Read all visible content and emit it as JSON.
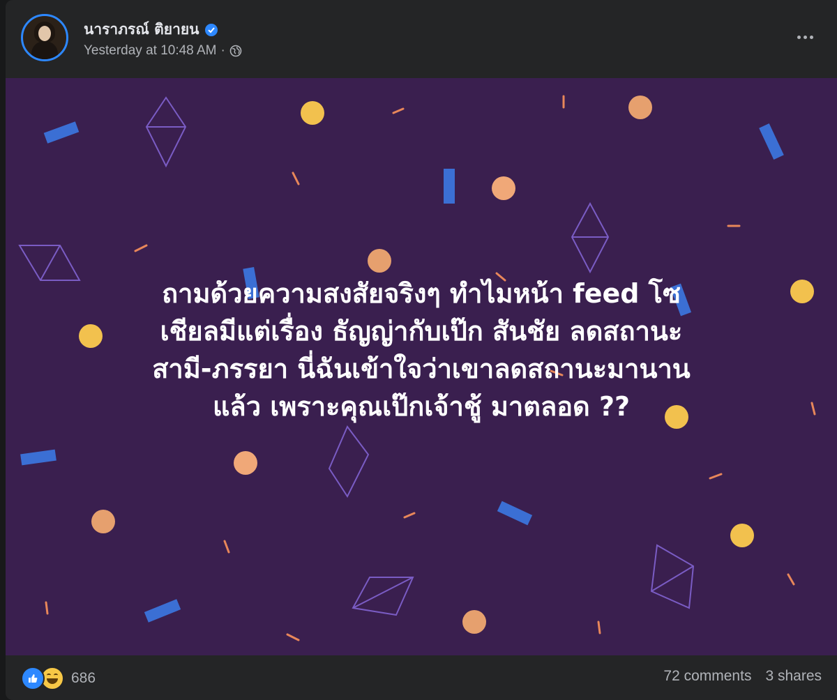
{
  "post": {
    "author": "นาราภรณ์ ติยายน",
    "timestamp": "Yesterday at 10:48 AM",
    "separator": "·",
    "audience_icon": "globe-icon",
    "verified_icon": "verified-badge-icon",
    "more_icon": "more-options-icon",
    "text_lines": [
      "ถามด้วยความสงสัยจริงๆ ทำไมหน้า feed โซ",
      "เชียลมีแต่เรื่อง ธัญญ่ากับเป๊ก สันชัย ลดสถานะ",
      "สามี-ภรรยา นี่ฉันเข้าใจว่าเขาลดสถานะมานาน",
      "แล้ว เพราะคุณเป๊กเจ้าชู้ มาตลอด ??"
    ]
  },
  "footer": {
    "reaction_icons": [
      "like-icon",
      "haha-icon"
    ],
    "reaction_count": "686",
    "comments": "72 comments",
    "shares": "3 shares"
  },
  "colors": {
    "background": "#3a1f4f",
    "card": "#242526",
    "accent": "#2d88ff",
    "text_primary": "#e4e6eb",
    "text_secondary": "#b0b3b8"
  }
}
